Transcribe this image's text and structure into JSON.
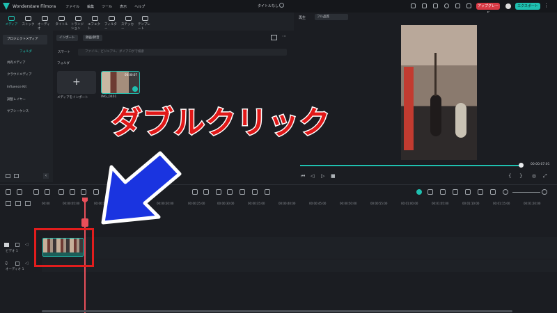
{
  "app": {
    "name": "Wonderstare Filmora",
    "title": "タイトルなし"
  },
  "menu": [
    "ファイル",
    "編集",
    "ツール",
    "表示",
    "ヘルプ"
  ],
  "header_buttons": {
    "upgrade": "アップグレード",
    "export": "エクスポート"
  },
  "toolbar": [
    {
      "label": "メディア",
      "active": true
    },
    {
      "label": "ストック"
    },
    {
      "label": "オーディオ"
    },
    {
      "label": "タイトル"
    },
    {
      "label": "トランジション"
    },
    {
      "label": "エフェクト"
    },
    {
      "label": "フィルター"
    },
    {
      "label": "ステッカー"
    },
    {
      "label": "テンプレート"
    }
  ],
  "sidebar": {
    "project_media": "プロジェクトメディア",
    "folder": "フォルダ",
    "items": [
      "共有メディア",
      "クラウドメディア",
      "Influence Kit",
      "調整レイヤー",
      "サブシーケンス"
    ]
  },
  "media": {
    "import_label": "インポート",
    "record_label": "録画/録音",
    "smart_label": "スマート",
    "search_placeholder": "ファイル、ビジュアル、ダイアログで検索",
    "folder_label": "フォルダ",
    "import_tile_label": "メディアをインポート",
    "clip_name": "IMG_0401",
    "clip_duration": "00:00:07"
  },
  "preview": {
    "label": "再生",
    "quality": "フル品質",
    "timecode": "00:00:07:01",
    "progress": 1.0
  },
  "timeline": {
    "ticks": [
      "00:00",
      "00:00:05:00",
      "00:00:10:00",
      "00:00:15:00",
      "00:00:20:00",
      "00:00:25:00",
      "00:00:30:00",
      "00:00:35:00",
      "00:00:40:00",
      "00:00:45:00",
      "00:00:50:00",
      "00:00:55:00",
      "00:01:00:00",
      "00:01:05:00",
      "00:01:10:00",
      "00:01:15:00",
      "00:01:20:00"
    ],
    "video_track": "ビデオ 1",
    "audio_track": "オーディオ 1"
  },
  "annotation": {
    "text": "ダブルクリック",
    "color": "#e01818",
    "arrow_color": "#1a34e0"
  },
  "colors": {
    "accent": "#1fc0b0",
    "playhead": "#e84f5a",
    "upgrade": "#d83a45"
  }
}
